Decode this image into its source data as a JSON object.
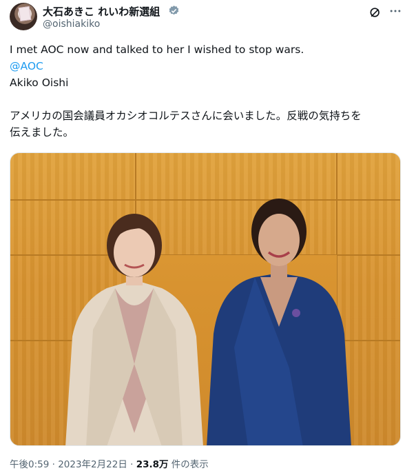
{
  "author": {
    "display_name": "大石あきこ れいわ新選組",
    "handle": "@oishiakiko",
    "verified": true
  },
  "icons": {
    "verified": "verified-badge-icon",
    "grok": "grok-icon",
    "more": "more-options-icon"
  },
  "tweet": {
    "line1": "I met AOC now and talked to her I wished to stop wars.",
    "mention": "@AOC",
    "signature": "Akiko Oishi",
    "jp_line1": "アメリカの国会議員オカシオコルテスさんに会いました。反戦の気持ちを",
    "jp_line2": "伝えました。"
  },
  "footer": {
    "time": "午後0:59",
    "sep1": " · ",
    "date": "2023年2月22日",
    "sep2": " · ",
    "views_count": "23.8万",
    "views_label": " 件の表示"
  },
  "colors": {
    "link": "#1d9bf0",
    "secondary_text": "#536471",
    "primary_text": "#0f1419",
    "verified": "#829aab"
  }
}
